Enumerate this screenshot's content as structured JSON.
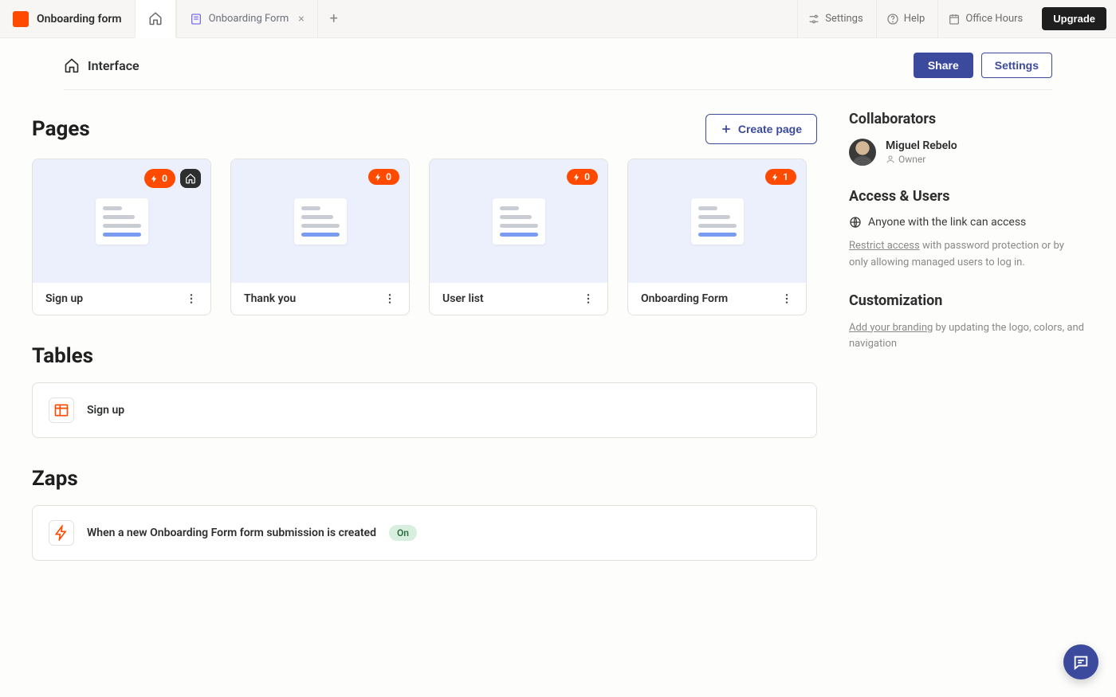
{
  "topbar": {
    "app_title": "Onboarding form",
    "tabs": [
      {
        "label": "Onboarding Form"
      }
    ],
    "links": {
      "settings": "Settings",
      "help": "Help",
      "office_hours": "Office Hours"
    },
    "upgrade": "Upgrade"
  },
  "subheader": {
    "title": "Interface",
    "share": "Share",
    "settings": "Settings"
  },
  "pages": {
    "title": "Pages",
    "create": "Create page",
    "items": [
      {
        "title": "Sign up",
        "bolt_count": "0",
        "is_home": true
      },
      {
        "title": "Thank you",
        "bolt_count": "0",
        "is_home": false
      },
      {
        "title": "User list",
        "bolt_count": "0",
        "is_home": false
      },
      {
        "title": "Onboarding Form",
        "bolt_count": "1",
        "is_home": false
      }
    ]
  },
  "tables": {
    "title": "Tables",
    "items": [
      {
        "title": "Sign up"
      }
    ]
  },
  "zaps": {
    "title": "Zaps",
    "items": [
      {
        "title": "When a new Onboarding Form form submission is created",
        "status": "On"
      }
    ]
  },
  "sidebar": {
    "collaborators": {
      "heading": "Collaborators",
      "user_name": "Miguel Rebelo",
      "user_role": "Owner"
    },
    "access": {
      "heading": "Access & Users",
      "status": "Anyone with the link can access",
      "restrict_link": "Restrict access",
      "restrict_rest": " with password protection or by only allowing managed users to log in."
    },
    "customization": {
      "heading": "Customization",
      "branding_link": "Add your branding",
      "branding_rest": " by updating the logo, colors, and navigation"
    }
  }
}
